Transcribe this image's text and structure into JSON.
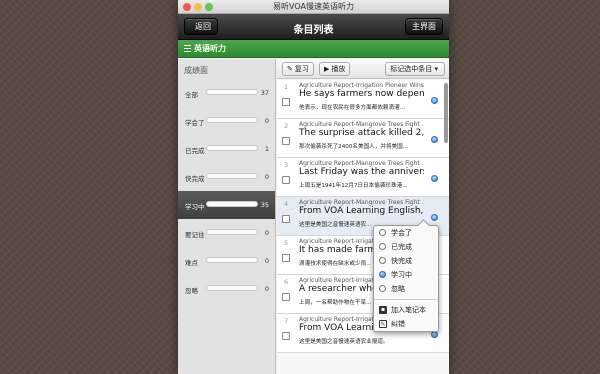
{
  "window": {
    "title": "易听VOA慢速英语听力"
  },
  "navbar": {
    "back_label": "返回",
    "title": "条目列表",
    "home_label": "主界面"
  },
  "category": {
    "label": "英语听力"
  },
  "stats": {
    "header": "成绩面",
    "items": [
      {
        "label": "全部",
        "count": "37",
        "fraction": 0
      },
      {
        "label": "学会了",
        "count": "0",
        "fraction": 0
      },
      {
        "label": "已完成",
        "count": "1",
        "fraction": 0.04
      },
      {
        "label": "快完成",
        "count": "0",
        "fraction": 0
      },
      {
        "label": "学习中",
        "count": "35",
        "fraction": 0.95
      },
      {
        "label": "要记住",
        "count": "0",
        "fraction": 0
      },
      {
        "label": "难点",
        "count": "0",
        "fraction": 0
      },
      {
        "label": "忽略",
        "count": "0",
        "fraction": 0
      }
    ]
  },
  "toolbar": {
    "review_label": "复习",
    "play_label": "播放",
    "mark_label": "标记选中条目"
  },
  "rows": [
    {
      "index": "1",
      "meta": "Agriculture Report-Irrigation Pioneer Wins ...",
      "title": "He says farmers now depend o...",
      "zh": "他表示，现在农民在很多方面都依赖滴灌..."
    },
    {
      "index": "2",
      "meta": "Agriculture Report-Mangrove Trees Fight ...",
      "title": "The surprise attack killed 2,400...",
      "zh": "那次偷袭杀死了2400名美国人，并将美国..."
    },
    {
      "index": "3",
      "meta": "Agriculture Report-Mangrove Trees Fight ...",
      "title": "Last Friday was the anniversar...",
      "zh": "上周五是1941年12月7日日本偷袭珍珠港..."
    },
    {
      "index": "4",
      "meta": "Agriculture Report-Mangrove Trees Fight ...",
      "title": "From VOA Learning English, th...",
      "zh": "这里是美国之音慢速英语农..."
    },
    {
      "index": "5",
      "meta": "Agriculture Report-Irrigation ...",
      "title": "It has made farming...",
      "zh": "滴灌技术使得在缺水或少雨..."
    },
    {
      "index": "6",
      "meta": "Agriculture Report-Irrigation ...",
      "title": "A researcher who his...",
      "zh": "上周，一名帮助作物在干旱..."
    },
    {
      "index": "7",
      "meta": "Agriculture Report-Irrigation ...",
      "title": "From VOA Learning English, th...",
      "zh": "这里是美国之音慢速英语农业报道。"
    }
  ],
  "popup": {
    "options": [
      {
        "label": "学会了",
        "selected": false
      },
      {
        "label": "已完成",
        "selected": false
      },
      {
        "label": "快完成",
        "selected": false
      },
      {
        "label": "学习中",
        "selected": true
      },
      {
        "label": "忽略",
        "selected": false
      }
    ],
    "add_note_label": "加入笔记本",
    "correct_label": "纠错"
  }
}
